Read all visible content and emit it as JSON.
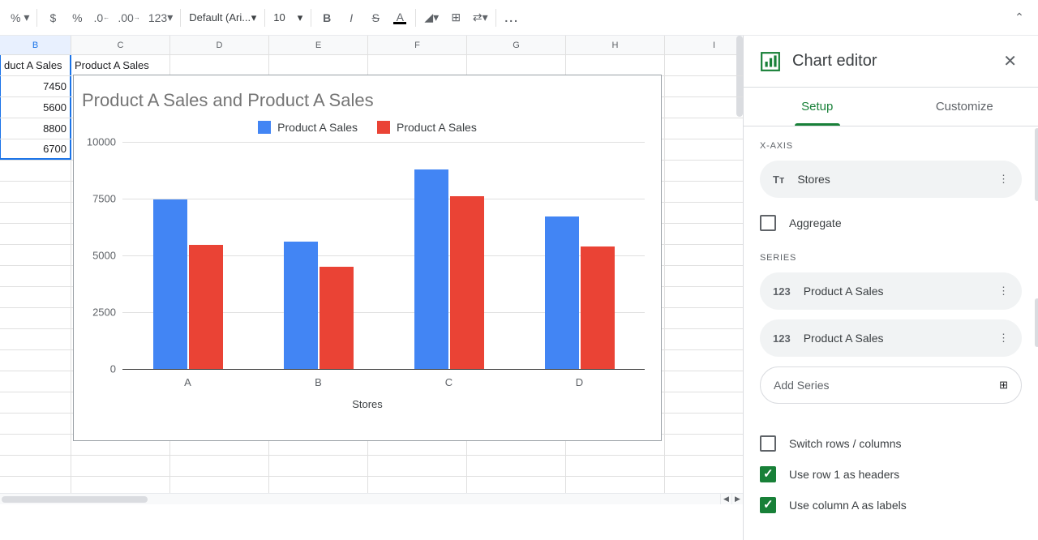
{
  "toolbar": {
    "percent": "%",
    "dollar": "$",
    "decimal_dec": ".0",
    "decimal_inc": ".00",
    "format123": "123",
    "font": "Default (Ari...",
    "size": "10",
    "bold": "B",
    "italic": "I",
    "strike": "S",
    "text_color": "A",
    "more": "..."
  },
  "columns": [
    "B",
    "C",
    "D",
    "E",
    "F",
    "G",
    "H",
    "I"
  ],
  "header_cells": [
    "duct A Sales",
    "Product A Sales"
  ],
  "data_values": [
    7450,
    5600,
    8800,
    6700
  ],
  "panel": {
    "title": "Chart editor",
    "tabs": {
      "setup": "Setup",
      "customize": "Customize"
    },
    "xaxis_label": "X-AXIS",
    "xaxis_value": "Stores",
    "aggregate": "Aggregate",
    "series_label": "SERIES",
    "series1": "Product A Sales",
    "series2": "Product A Sales",
    "add_series": "Add Series",
    "switch": "Switch rows / columns",
    "row1": "Use row 1 as headers",
    "colA": "Use column A as labels"
  },
  "chart_data": {
    "type": "bar",
    "title": "Product A Sales and Product A Sales",
    "xlabel": "Stores",
    "ylabel": "",
    "ylim": [
      0,
      10000
    ],
    "y_ticks": [
      0,
      2500,
      5000,
      7500,
      10000
    ],
    "categories": [
      "A",
      "B",
      "C",
      "D"
    ],
    "series": [
      {
        "name": "Product A Sales",
        "color": "#4285f4",
        "values": [
          7450,
          5600,
          8800,
          6700
        ]
      },
      {
        "name": "Product A Sales",
        "color": "#ea4335",
        "values": [
          5450,
          4500,
          7600,
          5400
        ]
      }
    ]
  }
}
